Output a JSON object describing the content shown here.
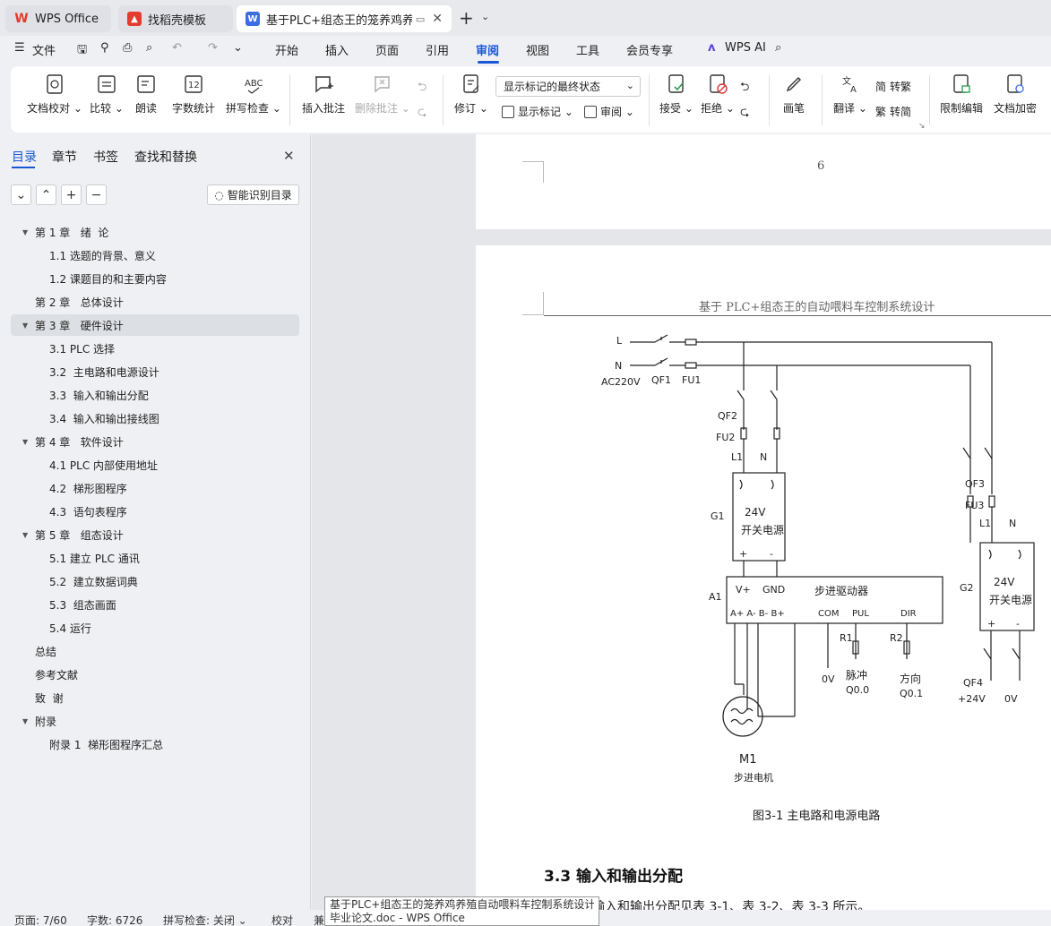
{
  "titlebar": {
    "tabs": [
      {
        "label": "WPS Office"
      },
      {
        "label": "找稻壳模板"
      },
      {
        "label": "基于PLC+组态王的笼养鸡养殖"
      }
    ]
  },
  "menu": {
    "file": "文件",
    "items": [
      "开始",
      "插入",
      "页面",
      "引用",
      "审阅",
      "视图",
      "工具",
      "会员专享"
    ],
    "active": "审阅",
    "wps_ai": "WPS AI"
  },
  "ribbon": {
    "doc_proof": "文档校对",
    "compare": "比较",
    "read_aloud": "朗读",
    "word_count": "字数统计",
    "spell_check": "拼写检查",
    "insert_comment": "插入批注",
    "delete_comment": "删除批注",
    "revise": "修订",
    "markup_mode": "显示标记的最终状态",
    "show_markup": "显示标记",
    "review": "审阅",
    "accept": "接受",
    "reject": "拒绝",
    "pen": "画笔",
    "translate": "翻译",
    "to_traditional": "转繁",
    "to_simplified": "转简",
    "restrict_edit": "限制编辑",
    "encrypt": "文档加密"
  },
  "sidebar": {
    "tabs": [
      "目录",
      "章节",
      "书签",
      "查找和替换"
    ],
    "smart_toc": "智能识别目录",
    "toc": [
      {
        "text": "第 1 章   绪  论",
        "level": 1,
        "expanded": true
      },
      {
        "text": "1.1 选题的背景、意义",
        "level": 2
      },
      {
        "text": "1.2 课题目的和主要内容",
        "level": 2
      },
      {
        "text": "第 2 章   总体设计",
        "level": 1
      },
      {
        "text": "第 3 章   硬件设计",
        "level": 1,
        "expanded": true,
        "selected": true
      },
      {
        "text": "3.1 PLC 选择",
        "level": 2
      },
      {
        "text": "3.2  主电路和电源设计",
        "level": 2
      },
      {
        "text": "3.3  输入和输出分配",
        "level": 2
      },
      {
        "text": "3.4  输入和输出接线图",
        "level": 2
      },
      {
        "text": "第 4 章   软件设计",
        "level": 1,
        "expanded": true
      },
      {
        "text": "4.1 PLC 内部使用地址",
        "level": 2
      },
      {
        "text": "4.2  梯形图程序",
        "level": 2
      },
      {
        "text": "4.3  语句表程序",
        "level": 2
      },
      {
        "text": "第 5 章   组态设计",
        "level": 1,
        "expanded": true
      },
      {
        "text": "5.1 建立 PLC 通讯",
        "level": 2
      },
      {
        "text": "5.2  建立数据词典",
        "level": 2
      },
      {
        "text": "5.3  组态画面",
        "level": 2
      },
      {
        "text": "5.4 运行",
        "level": 2
      },
      {
        "text": "总结",
        "level": 1
      },
      {
        "text": "参考文献",
        "level": 1
      },
      {
        "text": "致  谢",
        "level": 1
      },
      {
        "text": "附录",
        "level": 1,
        "expanded": true
      },
      {
        "text": "附录 1  梯形图程序汇总",
        "level": 2
      }
    ]
  },
  "document": {
    "page_number": "6",
    "header": "基于 PLC+组态王的自动喂料车控制系统设计",
    "diagram": {
      "L": "L",
      "N": "N",
      "AC220V": "AC220V",
      "QF1": "QF1",
      "FU1": "FU1",
      "QF2": "QF2",
      "FU2": "FU2",
      "L1": "L1",
      "N1": "N",
      "G1": "G1",
      "psu1_v": "24V",
      "psu1_name": "开关电源",
      "A1": "A1",
      "drv_vplus": "V+",
      "drv_gnd": "GND",
      "drv_name": "步进驱动器",
      "drv_pins": "A+ A- B- B+",
      "com": "COM",
      "pul": "PUL",
      "dir": "DIR",
      "R1": "R1",
      "R2": "R2",
      "ov": "0V",
      "pulse": "脉冲",
      "q00": "Q0.0",
      "direction": "方向",
      "q01": "Q0.1",
      "M1": "M1",
      "motor": "步进电机",
      "QF3": "QF3",
      "FU3": "FU3",
      "L1b": "L1",
      "Nb": "N",
      "G2": "G2",
      "psu2_v": "24V",
      "psu2_name": "开关电源",
      "QF4": "QF4",
      "p24": "+24V",
      "ov2": "0V",
      "plus": "+",
      "minus": "-"
    },
    "caption": "图3-1  主电路和电源电路",
    "section_heading": "3.3  输入和输出分配",
    "body_partial": "输入和输出分配见表 3-1、表 3-2、表 3-3 所示。"
  },
  "statusbar": {
    "page": "页面: 7/60",
    "words": "字数: 6726",
    "spell": "拼写检查: 关闭",
    "proof": "校对",
    "compat": "兼"
  },
  "tooltip": {
    "line1": "基于PLC+组态王的笼养鸡养殖自动喂料车控制系统设计",
    "line2": "毕业论文.doc - WPS Office"
  },
  "colors": {
    "accent": "#1a57d6",
    "wps_red": "#e33b2e",
    "doc_blue": "#3b6fe0"
  }
}
